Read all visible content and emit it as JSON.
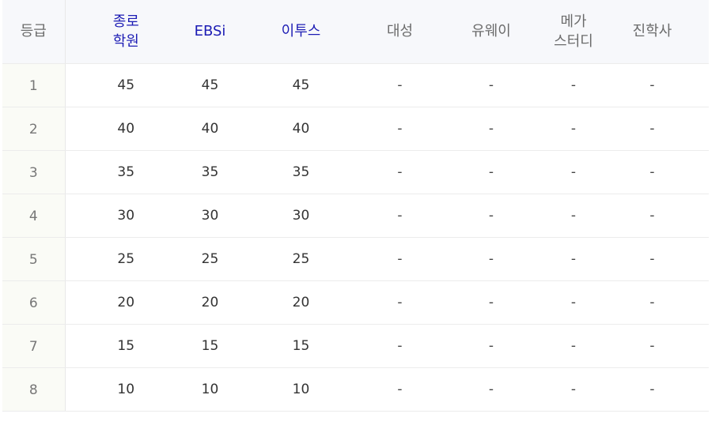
{
  "table": {
    "headers": [
      {
        "lines": [
          "등급"
        ],
        "accent": false
      },
      {
        "lines": [
          "종로",
          "학원"
        ],
        "accent": true
      },
      {
        "lines": [
          "EBSi"
        ],
        "accent": true
      },
      {
        "lines": [
          "이투스"
        ],
        "accent": true
      },
      {
        "lines": [
          "대성"
        ],
        "accent": false
      },
      {
        "lines": [
          "유웨이"
        ],
        "accent": false
      },
      {
        "lines": [
          "메가",
          "스터디"
        ],
        "accent": false
      },
      {
        "lines": [
          "진학사"
        ],
        "accent": false
      }
    ],
    "rows": [
      [
        "1",
        "45",
        "45",
        "45",
        "-",
        "-",
        "-",
        "-"
      ],
      [
        "2",
        "40",
        "40",
        "40",
        "-",
        "-",
        "-",
        "-"
      ],
      [
        "3",
        "35",
        "35",
        "35",
        "-",
        "-",
        "-",
        "-"
      ],
      [
        "4",
        "30",
        "30",
        "30",
        "-",
        "-",
        "-",
        "-"
      ],
      [
        "5",
        "25",
        "25",
        "25",
        "-",
        "-",
        "-",
        "-"
      ],
      [
        "6",
        "20",
        "20",
        "20",
        "-",
        "-",
        "-",
        "-"
      ],
      [
        "7",
        "15",
        "15",
        "15",
        "-",
        "-",
        "-",
        "-"
      ],
      [
        "8",
        "10",
        "10",
        "10",
        "-",
        "-",
        "-",
        "-"
      ]
    ]
  },
  "colors": {
    "accent_header": "#1c1cb4",
    "muted_header": "#6b6b6b",
    "header_bg": "#f7f8fb"
  }
}
